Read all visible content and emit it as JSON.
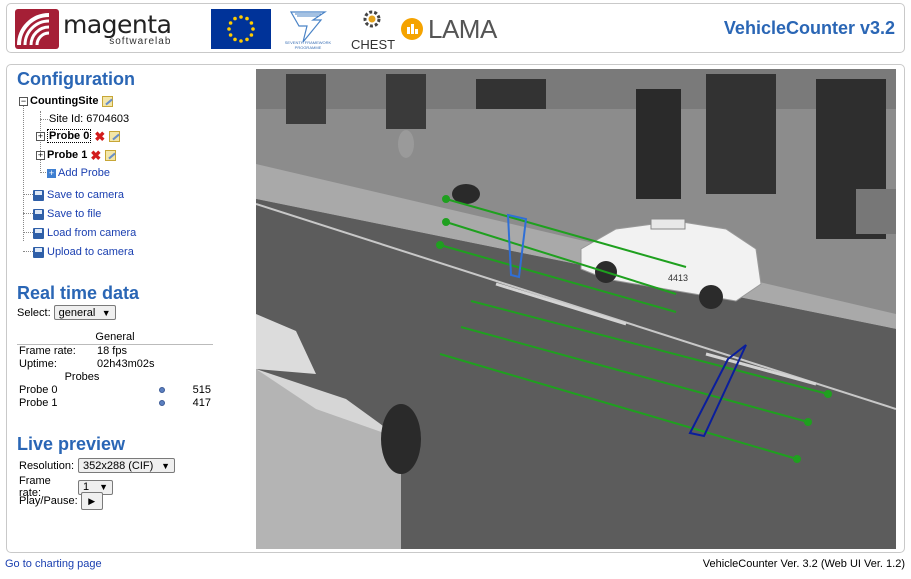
{
  "header": {
    "title": "VehicleCounter v3.2",
    "logos": {
      "magenta_word": "magenta",
      "magenta_sub": "softwarelab",
      "fp7_caption": "SEVENTH FRAMEWORK PROGRAMME",
      "chest": "CHEST",
      "lama": "LAMA"
    }
  },
  "configuration": {
    "title": "Configuration",
    "root_label": "CountingSite",
    "site_id": "Site Id: 6704603",
    "probes": [
      {
        "label": "Probe 0"
      },
      {
        "label": "Probe 1"
      }
    ],
    "add_probe": "Add Probe",
    "actions": [
      "Save to camera",
      "Save to file",
      "Load from camera",
      "Upload to camera"
    ]
  },
  "realtime": {
    "title": "Real time data",
    "select_label": "Select:",
    "select_value": "general",
    "general_header": "General",
    "frame_rate_label": "Frame rate:",
    "frame_rate_value": "18 fps",
    "uptime_label": "Uptime:",
    "uptime_value": "02h43m02s",
    "probes_header": "Probes",
    "probe_rows": [
      {
        "name": "Probe 0",
        "count": "515"
      },
      {
        "name": "Probe 1",
        "count": "417"
      }
    ]
  },
  "live_preview": {
    "title": "Live preview",
    "resolution_label": "Resolution:",
    "resolution_value": "352x288 (CIF)",
    "frame_rate_label": "Frame rate:",
    "frame_rate_value": "1",
    "play_pause_label": "Play/Pause:",
    "play_icon": "play-icon"
  },
  "video": {
    "counting_line_color": "#1fa01f",
    "probe_box_colors": [
      "#2f6fd6",
      "#0a1e9c"
    ],
    "vehicle_plate": "4413"
  },
  "footer": {
    "charting_link": "Go to charting page",
    "version": "VehicleCounter Ver. 3.2 (Web UI Ver. 1.2)"
  }
}
